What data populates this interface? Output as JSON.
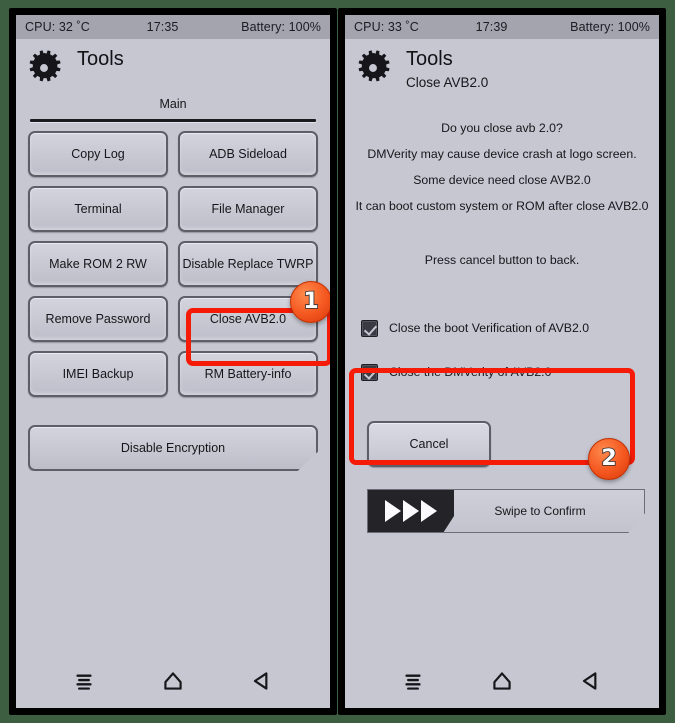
{
  "theme": {
    "outer_background": "#3e5e41",
    "panel_background": "#c6c7d1",
    "statusbar_background": "#a3a4ae",
    "annotation_color": "#f51b07",
    "badge_color": "#f4571f"
  },
  "left_panel": {
    "statusbar": {
      "cpu": "CPU: 32 ˚C",
      "time": "17:35",
      "battery": "Battery: 100%"
    },
    "header": {
      "icon": "gear-icon",
      "title": "Tools",
      "subtitle": ""
    },
    "page_label": "Main",
    "buttons": [
      "Copy Log",
      "ADB Sideload",
      "Terminal",
      "File Manager",
      "Make ROM 2 RW",
      "Disable Replace TWRP",
      "Remove Password",
      "Close AVB2.0",
      "IMEI Backup",
      "RM Battery-info"
    ],
    "wide_button": "Disable Encryption",
    "navbar": {
      "recents": "recents-icon",
      "home": "home-icon",
      "back": "back-icon"
    }
  },
  "right_panel": {
    "statusbar": {
      "cpu": "CPU: 33 ˚C",
      "time": "17:39",
      "battery": "Battery: 100%"
    },
    "header": {
      "icon": "gear-icon",
      "title": "Tools",
      "subtitle": "Close AVB2.0"
    },
    "message_lines": [
      "Do you close avb 2.0?",
      "DMVerity may cause device crash at logo screen.",
      "Some device need close AVB2.0",
      "It can boot custom system or ROM after close AVB2.0"
    ],
    "hint": "Press cancel button to back.",
    "checkboxes": [
      {
        "label": "Close the boot Verification of AVB2.0",
        "checked": true
      },
      {
        "label": "Close the DMVerity of AVB2.0",
        "checked": true
      }
    ],
    "cancel_label": "Cancel",
    "swipe_label": "Swipe to Confirm",
    "navbar": {
      "recents": "recents-icon",
      "home": "home-icon",
      "back": "back-icon"
    }
  },
  "annotations": [
    {
      "number": "1",
      "target": "Close AVB2.0 button"
    },
    {
      "number": "2",
      "target": "AVB2.0 checkbox group"
    }
  ]
}
